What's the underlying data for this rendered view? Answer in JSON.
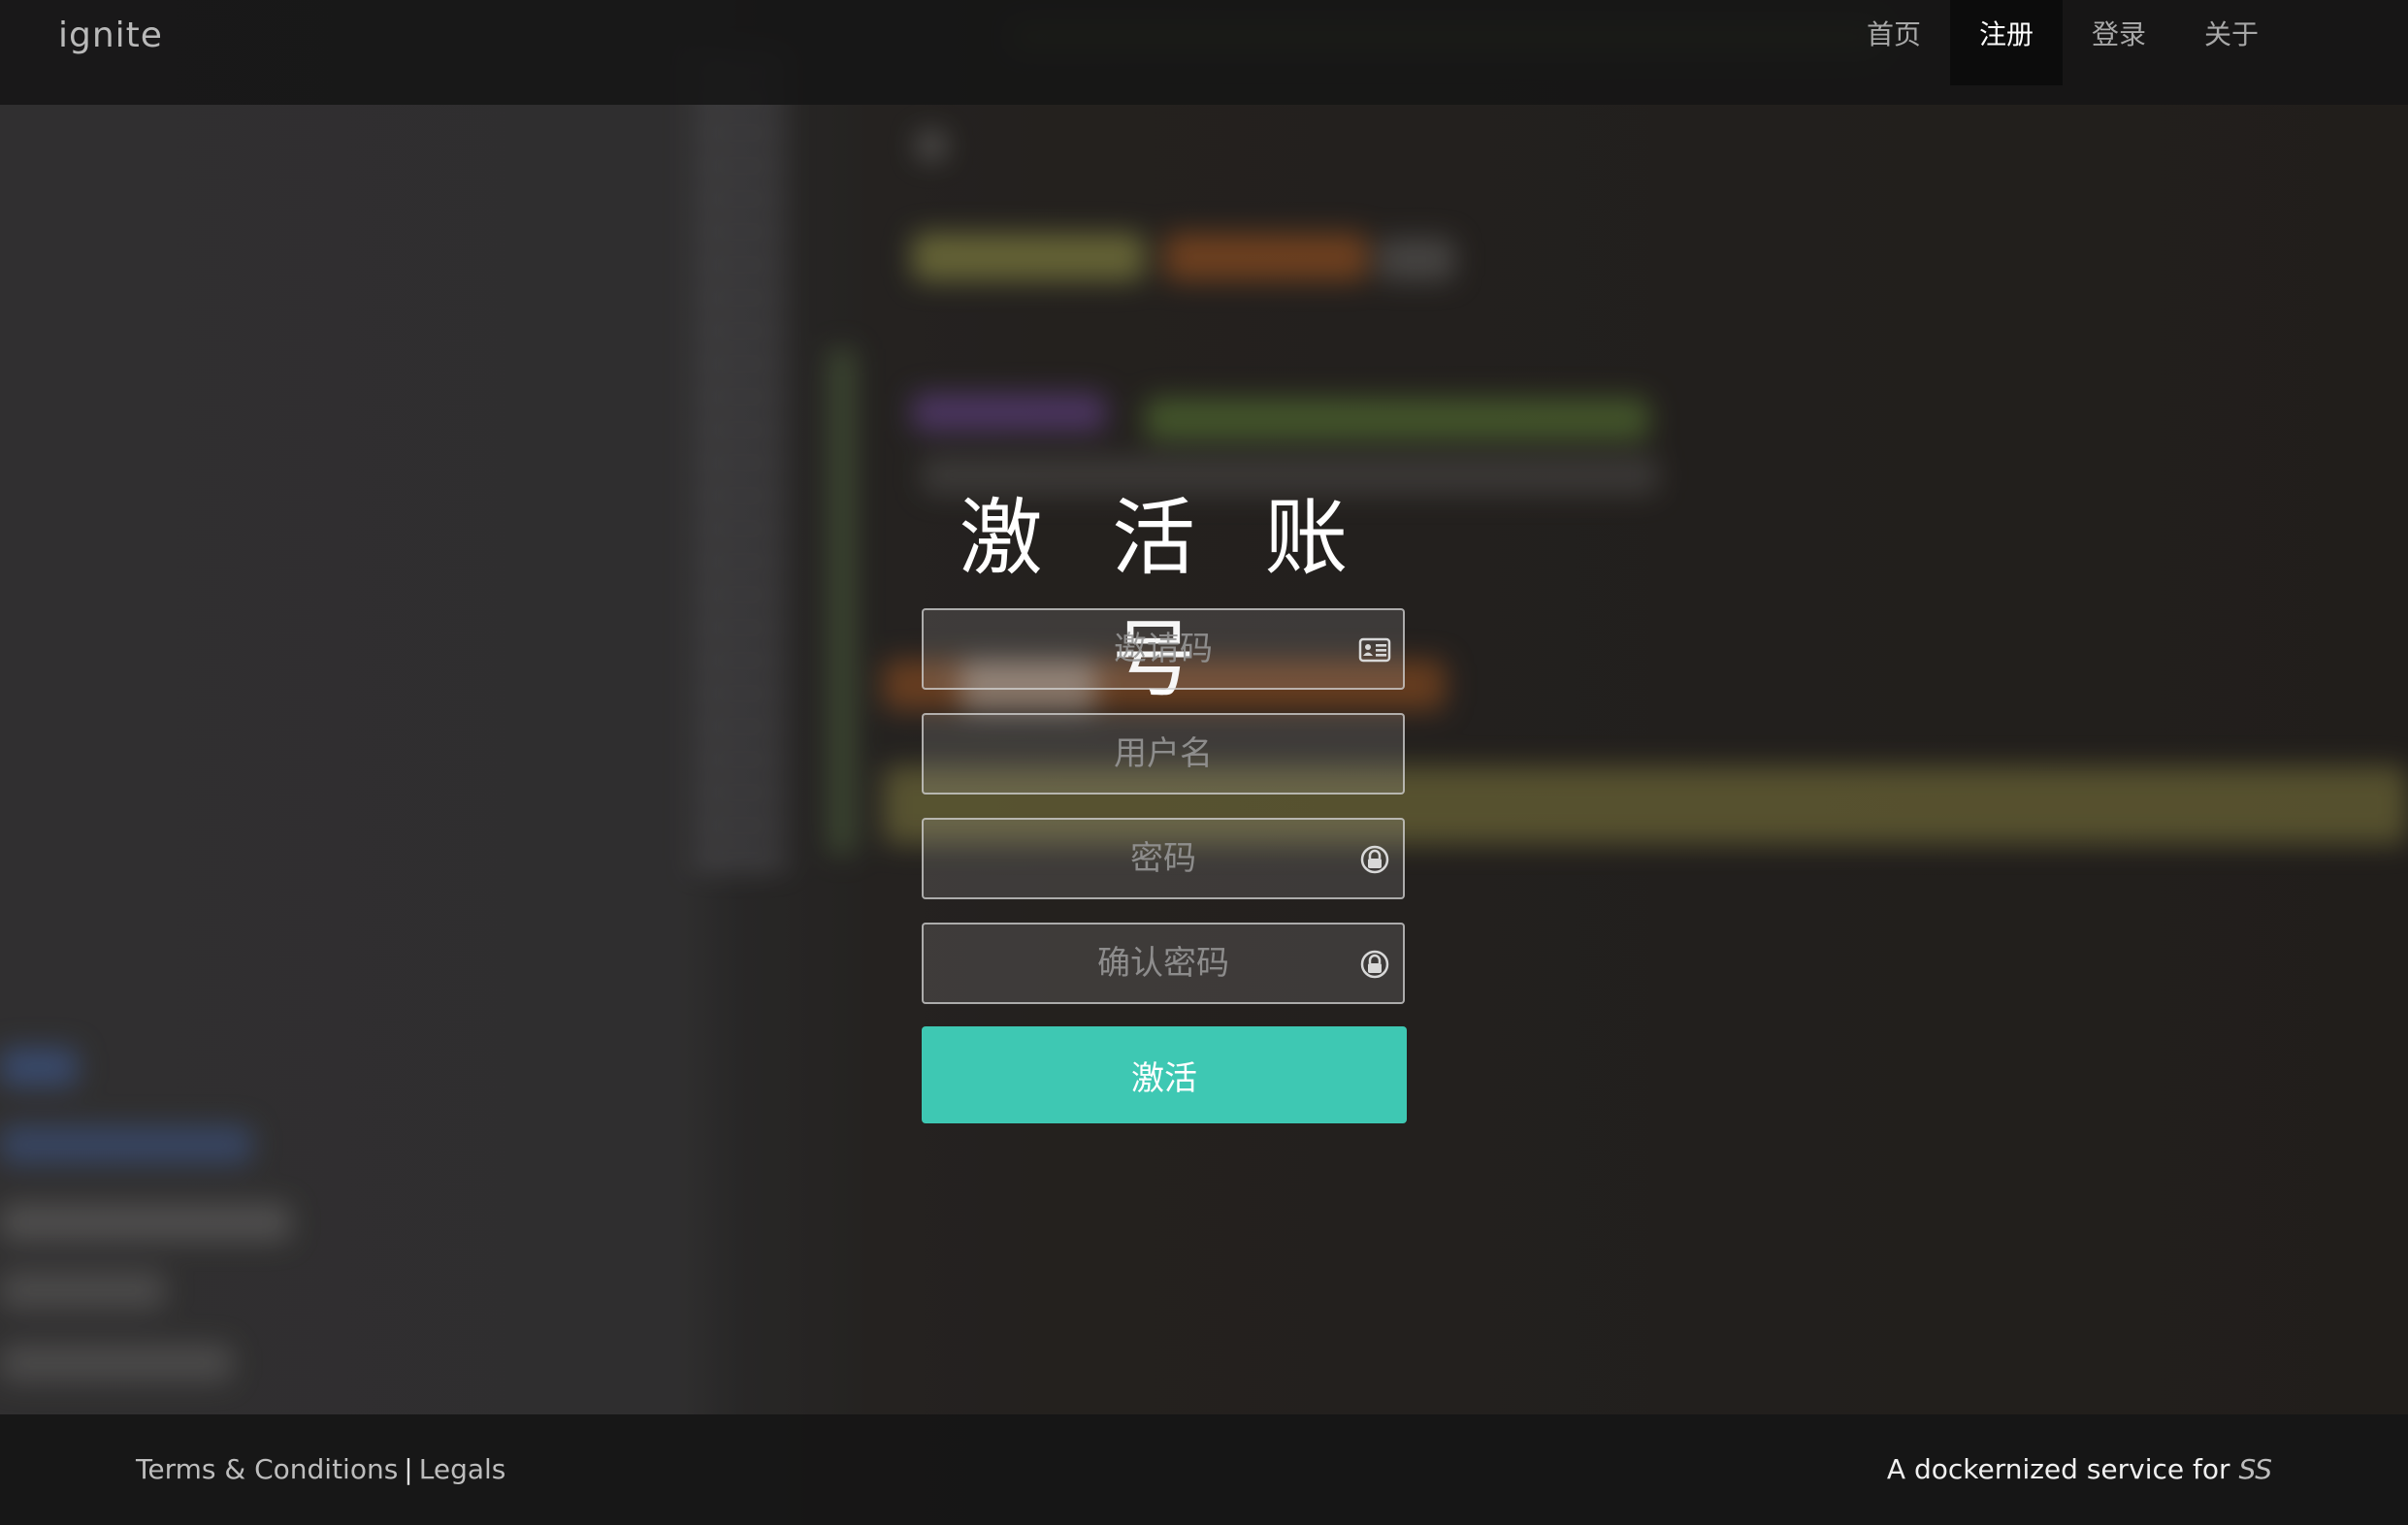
{
  "navbar": {
    "brand": "ignite",
    "items": [
      {
        "label": "首页",
        "active": false
      },
      {
        "label": "注册",
        "active": true
      },
      {
        "label": "登录",
        "active": false
      },
      {
        "label": "关于",
        "active": false
      }
    ]
  },
  "form": {
    "title": "激 活 账 号",
    "fields": [
      {
        "placeholder": "邀请码",
        "value": "",
        "icon": "id-card-icon"
      },
      {
        "placeholder": "用户名",
        "value": "",
        "icon": ""
      },
      {
        "placeholder": "密码",
        "value": "",
        "icon": "lock-icon"
      },
      {
        "placeholder": "确认密码",
        "value": "",
        "icon": "lock-icon"
      }
    ],
    "submit_label": "激活"
  },
  "footer": {
    "terms": "Terms & Conditions",
    "separator": "|",
    "legals": "Legals",
    "tagline": "A dockernized service for",
    "tagline_emphasis": "SS"
  },
  "colors": {
    "accent": "#3ec8b3",
    "nav_background": "#161616",
    "active_nav": "#0c0c0c"
  }
}
